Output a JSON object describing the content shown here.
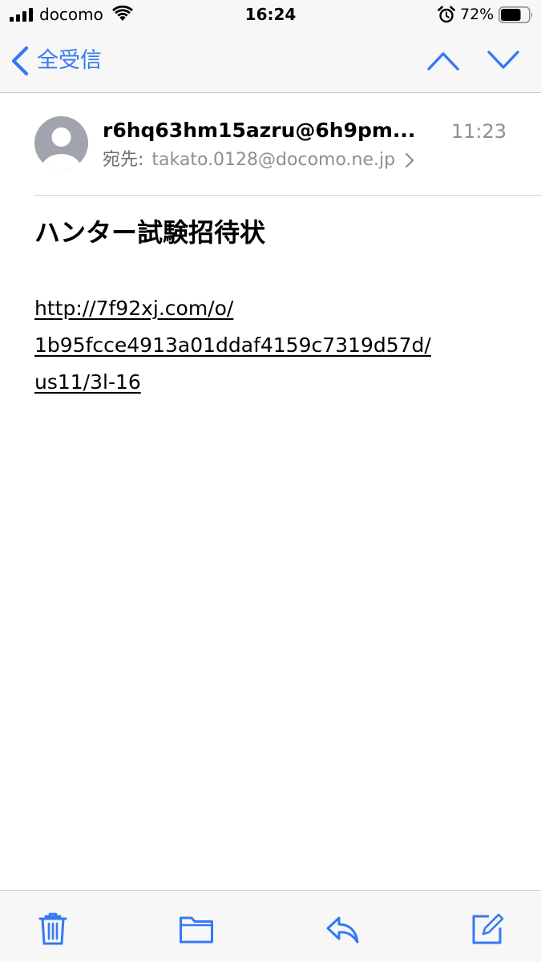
{
  "status_bar": {
    "carrier": "docomo",
    "time": "16:24",
    "battery_percent": "72%",
    "battery_level": 0.72,
    "signal_icon": "signal-bars-icon",
    "wifi_icon": "wifi-icon",
    "alarm_icon": "alarm-clock-icon"
  },
  "nav": {
    "back_label": "全受信",
    "back_icon": "chevron-left-icon",
    "prev_icon": "chevron-up-icon",
    "next_icon": "chevron-down-icon"
  },
  "message": {
    "sender": "r6hq63hm15azru@6h9pm...",
    "time": "11:23",
    "to_label": "宛先:",
    "to_address": "takato.0128@docomo.ne.jp",
    "subject": "ハンター試験招待状",
    "link_lines": [
      "http://7f92xj.com/o/",
      "1b95fcce4913a01ddaf4159c7319d57d/",
      "us11/3l-16"
    ]
  },
  "toolbar": {
    "icons": [
      "trash-icon",
      "folder-icon",
      "reply-icon",
      "compose-icon"
    ]
  },
  "colors": {
    "accent": "#3478f6",
    "secondary_text": "#8e8e93",
    "bar_background": "#f7f7f7",
    "avatar": "#a1a4ad"
  }
}
